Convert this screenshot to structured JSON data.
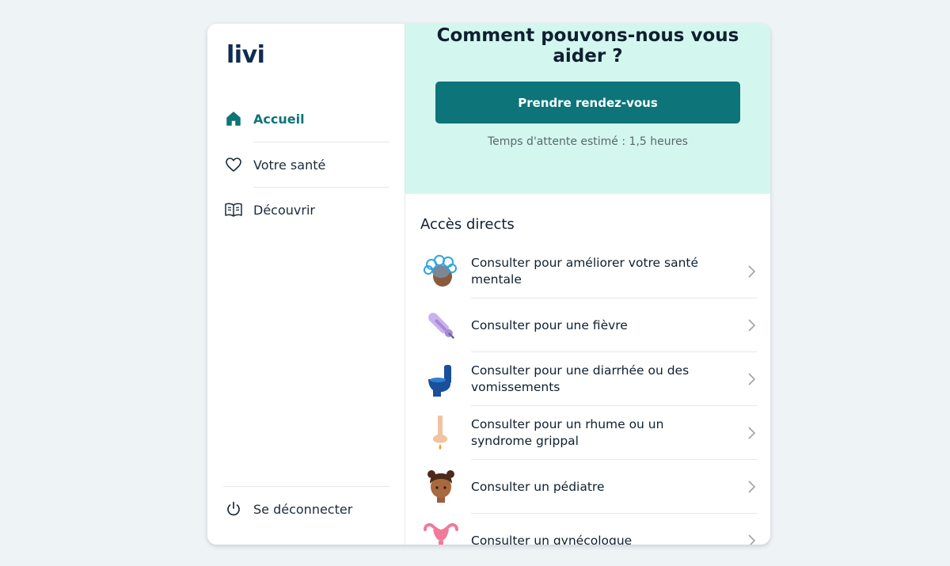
{
  "app": {
    "logo": "livi"
  },
  "sidebar": {
    "items": [
      {
        "label": "Accueil",
        "icon": "home-icon",
        "active": true
      },
      {
        "label": "Votre santé",
        "icon": "heart-icon",
        "active": false
      },
      {
        "label": "Découvrir",
        "icon": "book-icon",
        "active": false
      }
    ],
    "logout": {
      "label": "Se déconnecter",
      "icon": "power-icon"
    }
  },
  "hero": {
    "title": "Comment pouvons-nous vous aider ?",
    "cta_label": "Prendre rendez-vous",
    "wait_text": "Temps d'attente estimé : 1,5 heures"
  },
  "direct_access": {
    "title": "Accès directs",
    "items": [
      {
        "label": "Consulter pour améliorer votre santé mentale",
        "icon": "mental-health-icon"
      },
      {
        "label": "Consulter pour une fièvre",
        "icon": "thermometer-icon"
      },
      {
        "label": "Consulter pour une diarrhée ou des vomissements",
        "icon": "toilet-icon"
      },
      {
        "label": "Consulter pour un rhume ou un syndrome grippal",
        "icon": "nose-icon"
      },
      {
        "label": "Consulter un pédiatre",
        "icon": "child-icon"
      },
      {
        "label": "Consulter un gynécologue",
        "icon": "uterus-icon"
      }
    ]
  },
  "colors": {
    "brand_teal": "#0d7479",
    "hero_bg": "#d3f7ee",
    "logo_navy": "#0f2d4e",
    "page_bg": "#eef3f6"
  }
}
